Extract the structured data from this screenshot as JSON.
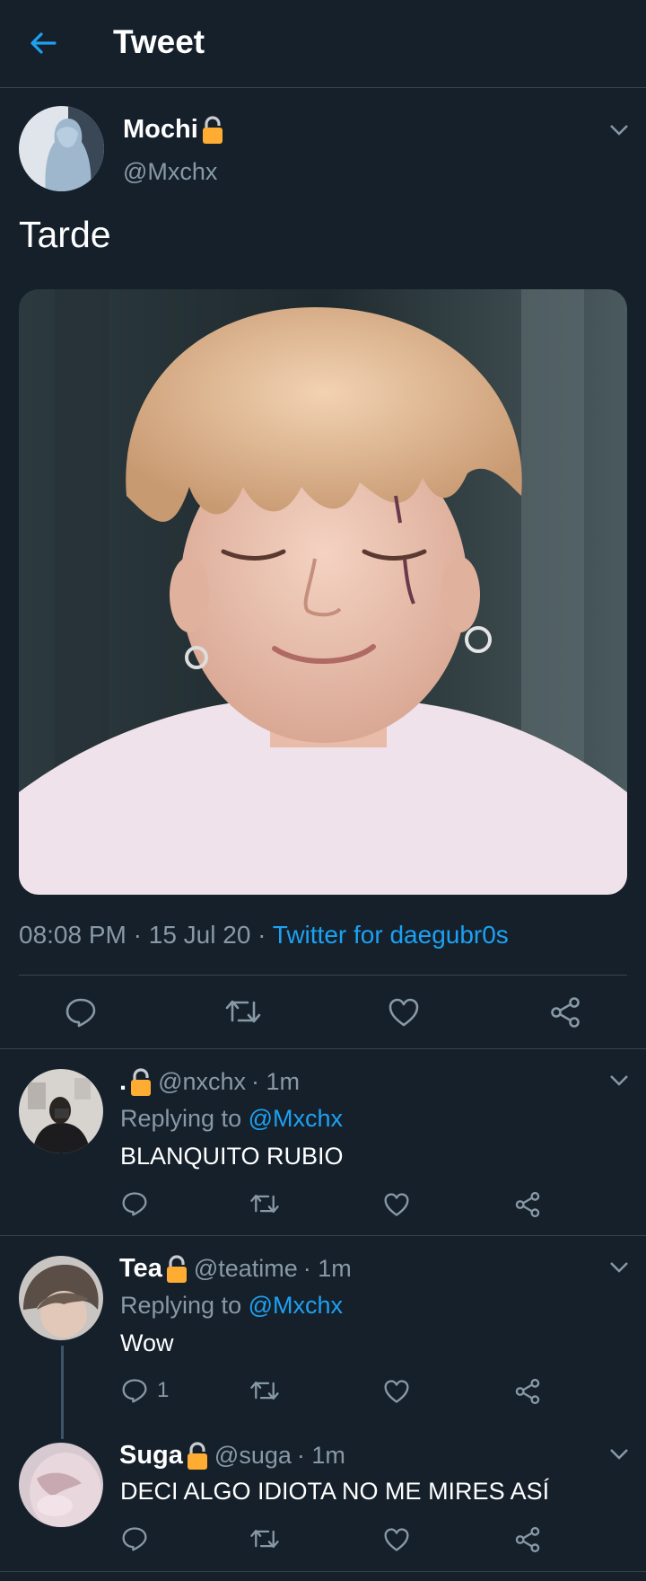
{
  "header": {
    "title": "Tweet",
    "back_icon": "arrow-left-icon"
  },
  "colors": {
    "background": "#15202b",
    "accent": "#1da1f2",
    "secondary_text": "#8899a6",
    "divider": "#38444d",
    "lock": "#ffac33"
  },
  "tweet": {
    "name": "Mochi",
    "handle": "@Mxchx",
    "text": "Tarde",
    "time": "08:08 PM",
    "sep1": " · ",
    "date": "15 Jul 20",
    "sep2": " · ",
    "source": "Twitter for daegubr0s",
    "media_description_icon": "photo-icon"
  },
  "replies": [
    {
      "name": ".",
      "handle": "@nxchx",
      "time": "· 1m",
      "replying_prefix": "Replying to ",
      "replying_to": "@Mxchx",
      "text": "BLANQUITO RUBIO",
      "reply_count": ""
    },
    {
      "name": "Tea",
      "handle": "@teatime",
      "time": "· 1m",
      "replying_prefix": "Replying to ",
      "replying_to": "@Mxchx",
      "text": "Wow",
      "reply_count": "1"
    },
    {
      "name": "Suga",
      "handle": "@suga",
      "time": "· 1m",
      "text": "DECI ALGO IDIOTA NO ME MIRES ASÍ",
      "reply_count": ""
    }
  ]
}
